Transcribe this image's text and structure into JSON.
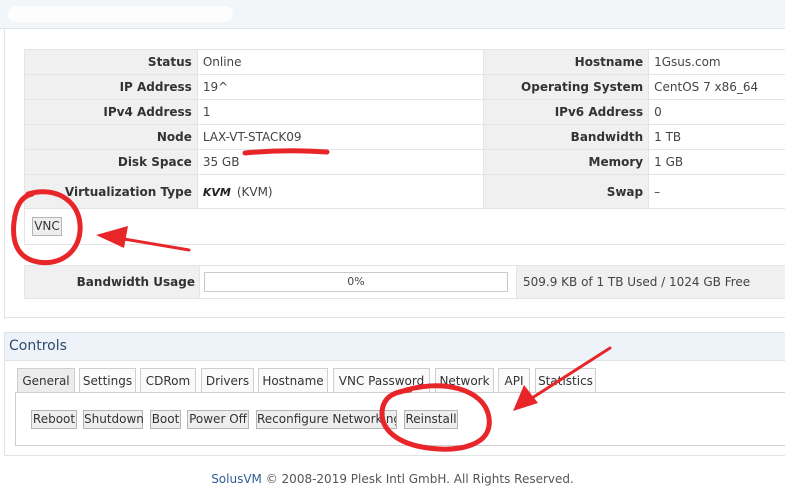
{
  "info_rows": [
    {
      "left_label": "Status",
      "left_value": "Online",
      "right_label": "Hostname",
      "right_value": "1Gsus.com"
    },
    {
      "left_label": "IP Address",
      "left_value": "19^",
      "right_label": "Operating System",
      "right_value": "CentOS 7 x86_64"
    },
    {
      "left_label": "IPv4 Address",
      "left_value": "1",
      "right_label": "IPv6 Address",
      "right_value": "0"
    },
    {
      "left_label": "Node",
      "left_value": "LAX-VT-STACK09",
      "right_label": "Bandwidth",
      "right_value": "1 TB"
    },
    {
      "left_label": "Disk Space",
      "left_value": "35 GB",
      "right_label": "Memory",
      "right_value": "1 GB"
    },
    {
      "left_label": "Virtualization Type",
      "left_value_logo": "KVM",
      "left_value": "(KVM)",
      "right_label": "Swap",
      "right_value": "–"
    }
  ],
  "vnc_button": "VNC",
  "bandwidth": {
    "label": "Bandwidth Usage",
    "percent_text": "0%",
    "percent": 0,
    "summary": "509.9 KB of 1 TB Used / 1024 GB Free"
  },
  "controls": {
    "title": "Controls",
    "tabs": [
      "General",
      "Settings",
      "CDRom",
      "Drivers",
      "Hostname",
      "VNC Password",
      "Network",
      "API",
      "Statistics"
    ],
    "active_tab": "General",
    "buttons": [
      "Reboot",
      "Shutdown",
      "Boot",
      "Power Off",
      "Reconfigure Networking",
      "Reinstall"
    ]
  },
  "footer": {
    "link": "SolusVM",
    "text": "© 2008-2019 Plesk Intl GmbH. All Rights Reserved."
  },
  "annotation_color": "#e8262a"
}
